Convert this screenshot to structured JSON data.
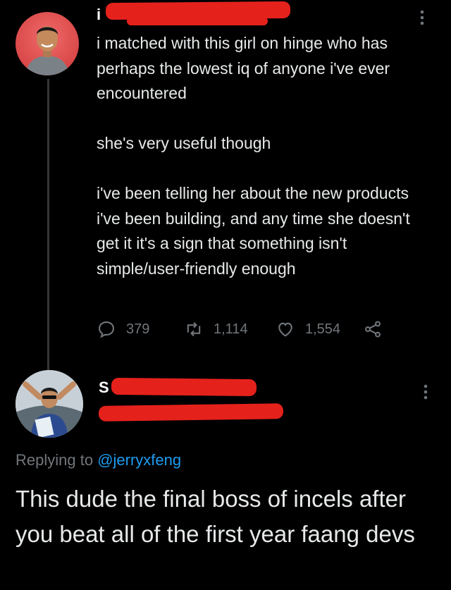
{
  "tweet1": {
    "author_name": "i",
    "paragraphs": [
      "i matched with this girl on hinge who has perhaps the lowest iq of anyone i've ever encountered",
      "she's very useful though",
      "i've been telling her about the new products i've been building, and any time she doesn't get it it's a sign that something isn't simple/user-friendly enough"
    ],
    "actions": {
      "replies": "379",
      "retweets": "1,114",
      "likes": "1,554"
    }
  },
  "tweet2": {
    "author_name": "S",
    "replying_prefix": "Replying to",
    "replying_handle": "@jerryxfeng",
    "text": "This dude the final boss of incels after you beat all of the first year faang devs"
  },
  "colors": {
    "background": "#000000",
    "text": "#e7e9ea",
    "muted": "#71767b",
    "link": "#1d9bf0",
    "redaction": "#e5211c"
  },
  "icons": [
    "more-icon",
    "reply-icon",
    "retweet-icon",
    "like-icon",
    "share-icon"
  ]
}
